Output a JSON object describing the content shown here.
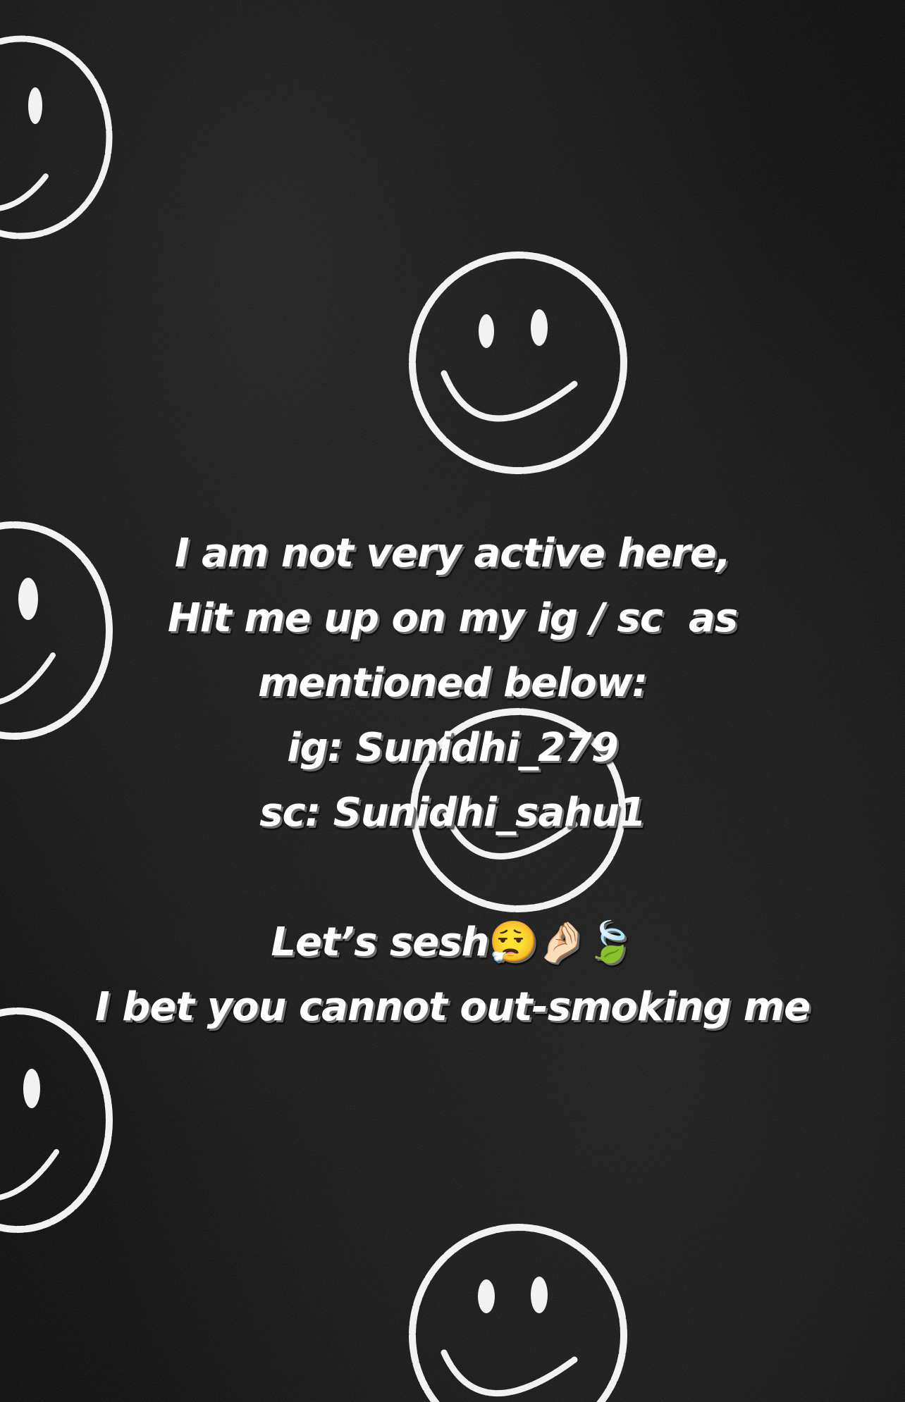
{
  "caption": {
    "line1": "I am not very active here,",
    "line2": "Hit me up on my ig / sc  as",
    "line3": "mentioned below:",
    "line4": "ig: Sunidhi_279",
    "line5": "sc: Sunidhi_sahu1",
    "line6": "Let’s sesh",
    "line7": "I bet you cannot out-smoking me"
  },
  "emojis": [
    "😮‍💨",
    "🤌🏻",
    "🍃"
  ],
  "colors": {
    "background": "#0b0b0b",
    "text": "#ffffff",
    "chalk": "#f2f2f2",
    "text_shadow": "#6d6d6d"
  },
  "icons": [
    "smiley-face-chalk-icon"
  ]
}
